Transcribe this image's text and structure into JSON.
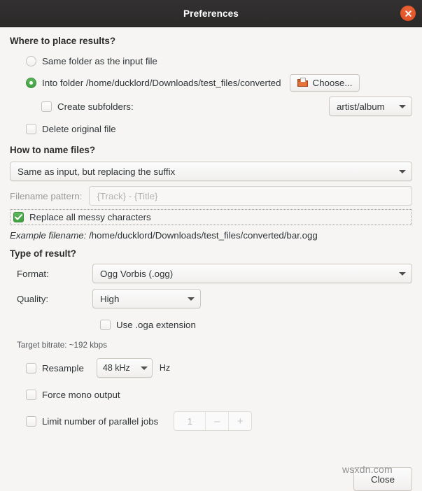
{
  "window": {
    "title": "Preferences",
    "close_icon": "close-icon",
    "accent_close": "#e0552a",
    "titlebar_bg": "#2f2d2c",
    "body_bg": "#f6f5f4",
    "check_green": "#4ca64c"
  },
  "placement": {
    "heading": "Where to place results?",
    "option_same_folder": "Same folder as the input file",
    "option_into_folder": "Into folder /home/ducklord/Downloads/test_files/converted",
    "choose_button": "Choose...",
    "choose_icon": "folder-icon",
    "create_subfolders": "Create subfolders:",
    "subfolder_pattern": "artist/album",
    "delete_original": "Delete original file",
    "selected": "into_folder",
    "create_subfolders_checked": false,
    "delete_original_checked": false
  },
  "naming": {
    "heading": "How to name files?",
    "scheme_value": "Same as input, but replacing the suffix",
    "filename_pattern_label": "Filename pattern:",
    "filename_pattern_placeholder": "{Track} - {Title}",
    "replace_messy": "Replace all messy characters",
    "replace_messy_checked": true,
    "example_label": "Example filename:",
    "example_path": "/home/ducklord/Downloads/test_files/converted/bar.ogg"
  },
  "result": {
    "heading": "Type of result?",
    "format_label": "Format:",
    "format_value": "Ogg Vorbis (.ogg)",
    "quality_label": "Quality:",
    "quality_value": "High",
    "oga_extension": "Use .oga extension",
    "oga_checked": false,
    "bitrate_hint": "Target bitrate: ~192 kbps",
    "resample_label": "Resample",
    "resample_checked": false,
    "resample_value": "48 kHz",
    "resample_unit": "Hz",
    "force_mono": "Force mono output",
    "force_mono_checked": false,
    "limit_jobs": "Limit number of parallel jobs",
    "limit_jobs_checked": false,
    "jobs_value": "1",
    "jobs_minus": "–",
    "jobs_plus": "+"
  },
  "footer": {
    "close_label": "Close"
  },
  "watermark": {
    "text": "wsxdn.com"
  }
}
